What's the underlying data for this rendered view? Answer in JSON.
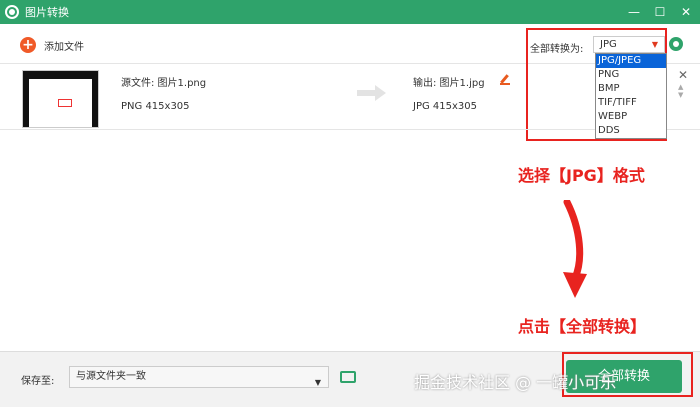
{
  "titlebar": {
    "title": "图片转换",
    "minimize": "—",
    "maximize": "☐",
    "close": "✕"
  },
  "toolbar": {
    "add_label": "添加文件",
    "convert_all_label": "全部转换为:",
    "format_value": "JPG"
  },
  "dropdown": {
    "options": [
      "JPG/JPEG",
      "PNG",
      "BMP",
      "TIF/TIFF",
      "WEBP",
      "DDS"
    ],
    "selected": "JPG/JPEG"
  },
  "file": {
    "source_label": "源文件: 图片1.png",
    "source_meta": "PNG  415x305",
    "output_label": "输出: 图片1.jpg",
    "output_meta": "JPG  415x305",
    "remove": "✕",
    "up": "▲",
    "down": "▼"
  },
  "annotations": {
    "step1": "选择【JPG】格式",
    "step2": "点击【全部转换】"
  },
  "bottom": {
    "save_to_label": "保存至:",
    "save_to_value": "与源文件夹一致",
    "convert_button": "全部转换"
  },
  "watermark": "掘金技术社区 @ 一罐小可乐",
  "colors": {
    "accent": "#2fa36b",
    "annotation": "#e8231f",
    "selection": "#0a64d8"
  }
}
